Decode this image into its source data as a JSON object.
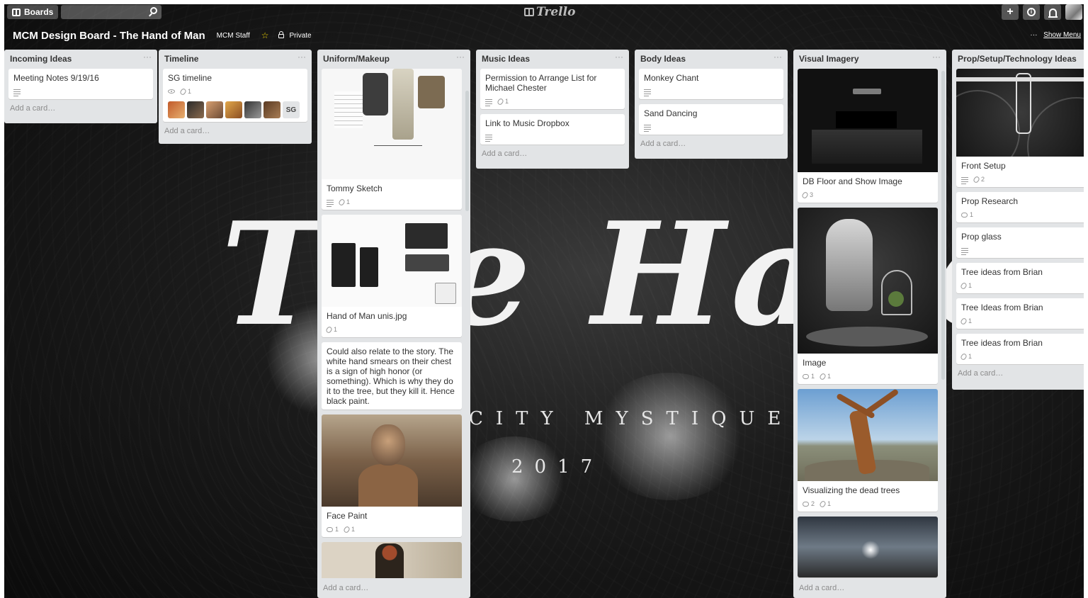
{
  "header": {
    "boards_label": "Boards",
    "search_placeholder": "",
    "logo_text": "Trello",
    "create_icon": "plus-icon",
    "info_icon": "info-icon",
    "notifications_icon": "bell-icon"
  },
  "board": {
    "title": "MCM Design Board - The Hand of Man",
    "team": "MCM Staff",
    "visibility": "Private",
    "show_menu_dots": "···",
    "show_menu": "Show Menu"
  },
  "background": {
    "title": "The Hand of Ma",
    "subtitle": "CITY MYSTIQUE",
    "year": "2017"
  },
  "colors": {
    "star": "#f2d600",
    "list_bg": "#e2e4e6",
    "card_bg": "#ffffff"
  },
  "add_card": "Add a card…",
  "lists": [
    {
      "title": "Incoming Ideas",
      "menu": "···",
      "cards": [
        {
          "title": "Meeting Notes 9/19/16"
        }
      ]
    },
    {
      "title": "Timeline",
      "menu": "···",
      "cards": [
        {
          "title": "SG timeline",
          "attachments": "1",
          "member_initials": "SG"
        }
      ]
    },
    {
      "title": "Uniform/Makeup",
      "menu": "···",
      "cards": [
        {
          "title": "Tommy Sketch",
          "attachments": "1"
        },
        {
          "title": "Hand of Man unis.jpg",
          "attachments": "1"
        },
        {
          "title": "Could also relate to the story. The white hand smears on their chest is a sign of high honor (or something). Which is why they do it to the tree, but they kill it. Hence black paint."
        },
        {
          "title": "Face Paint",
          "comments": "1",
          "attachments": "1"
        }
      ]
    },
    {
      "title": "Music Ideas",
      "menu": "···",
      "cards": [
        {
          "title": "Permission to Arrange List for Michael Chester",
          "attachments": "1"
        },
        {
          "title": "Link to Music Dropbox"
        }
      ]
    },
    {
      "title": "Body Ideas",
      "menu": "···",
      "cards": [
        {
          "title": "Monkey Chant"
        },
        {
          "title": "Sand Dancing"
        }
      ]
    },
    {
      "title": "Visual Imagery",
      "menu": "···",
      "cards": [
        {
          "title": "DB Floor and Show Image",
          "attachments": "3"
        },
        {
          "title": "Image",
          "comments": "1",
          "attachments": "1"
        },
        {
          "title": "Visualizing the dead trees",
          "comments": "2",
          "attachments": "1"
        }
      ]
    },
    {
      "title": "Prop/Setup/Technology Ideas",
      "menu": "···",
      "cards": [
        {
          "title": "Front Setup",
          "attachments": "2"
        },
        {
          "title": "Prop Research",
          "comments": "1"
        },
        {
          "title": "Prop glass"
        },
        {
          "title": "Tree ideas from Brian",
          "attachments": "1"
        },
        {
          "title": "Tree Ideas from Brian",
          "attachments": "1"
        },
        {
          "title": "Tree ideas from Brian",
          "attachments": "1"
        }
      ]
    }
  ]
}
